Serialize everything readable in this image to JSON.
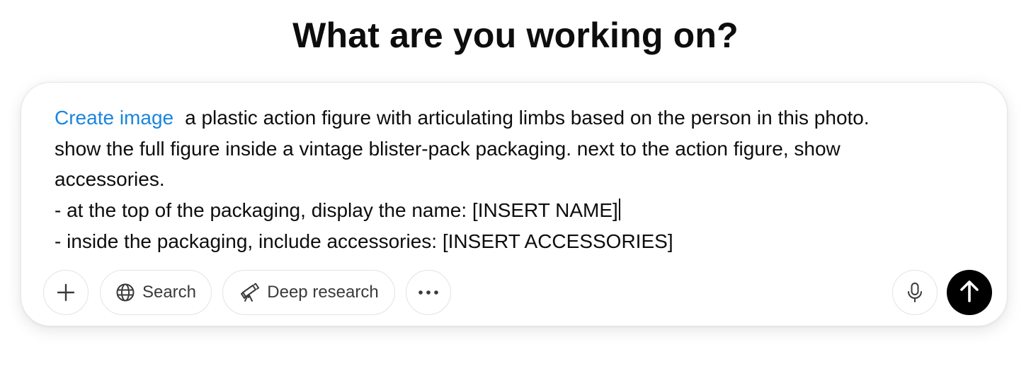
{
  "heading": "What are you working on?",
  "composer": {
    "tool_tag": "Create image",
    "lines": [
      "a plastic action figure with articulating limbs based on the person in this photo.",
      "show the full figure inside a vintage blister-pack packaging. next to the action figure, show",
      "accessories.",
      "- at the top of the packaging, display the name: [INSERT NAME]",
      "- inside the packaging, include accessories: [INSERT ACCESSORIES]"
    ]
  },
  "toolbar": {
    "add_icon": "plus-icon",
    "search_label": "Search",
    "search_icon": "globe-icon",
    "deep_research_label": "Deep research",
    "deep_research_icon": "telescope-icon",
    "more_icon": "ellipsis-icon",
    "mic_icon": "microphone-icon",
    "send_icon": "arrow-up-icon"
  },
  "colors": {
    "tool_tag": "#1a85e0",
    "send_button": "#000000",
    "border": "#e3e3e3"
  }
}
